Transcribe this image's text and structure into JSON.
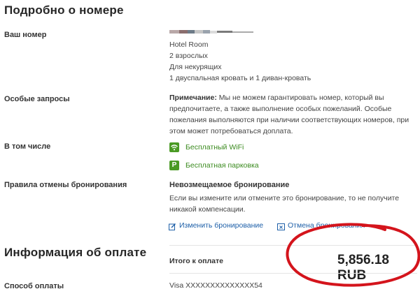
{
  "details": {
    "title": "Подробно о номере",
    "room": {
      "label": "Ваш номер",
      "lines": [
        "Hotel Room",
        "2 взрослых",
        "Для некурящих",
        "1 двуспальная кровать и 1 диван-кровать"
      ]
    },
    "special": {
      "label": "Особые запросы",
      "note_bold": "Примечание:",
      "note_text": "Мы не можем гарантировать номер, который вы предпочитаете, а также выполнение особых пожеланий. Особые пожелания выполняются при наличии соответствующих номеров, при этом может потребоваться доплата."
    },
    "included": {
      "label": "В том числе",
      "items": [
        {
          "icon": "wifi-icon",
          "text": "Бесплатный WiFi"
        },
        {
          "icon": "parking-icon",
          "text": "Бесплатная парковка"
        }
      ]
    },
    "cancel": {
      "label": "Правила отмены бронирования",
      "title": "Невозмещаемое бронирование",
      "text": "Если вы измените или отмените это бронирование, то не получите никакой компенсации.",
      "change_link": "Изменить бронирование",
      "cancel_link": "Отмена бронирования"
    }
  },
  "payment": {
    "title": "Информация об оплате",
    "total_label": "Итого к оплате",
    "total_value": "5,856.18 RUB",
    "method_label": "Способ оплаты",
    "method_value": "Visa XXXXXXXXXXXXXX54"
  },
  "colors": {
    "green_accent": "#3a8a1e",
    "link_blue": "#1d5fa8",
    "annotation_red": "#d4141c"
  }
}
